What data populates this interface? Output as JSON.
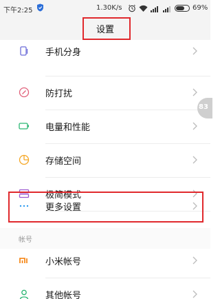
{
  "status_bar": {
    "time": "下午2:25",
    "network_speed": "1.30K/s",
    "battery_percent": "69%",
    "battery_level": 0.69,
    "icons": [
      "shield-icon",
      "alarm-icon",
      "wifi-icon",
      "signal-icon"
    ]
  },
  "header": {
    "title": "设置"
  },
  "settings": {
    "items": [
      {
        "label": "手机分身",
        "icon": "dual-app-icon",
        "color": "#6b6bd8"
      },
      {
        "label": "防打扰",
        "icon": "do-not-disturb-icon",
        "color": "#e0607a"
      },
      {
        "label": "电量和性能",
        "icon": "battery-icon",
        "color": "#2bb673"
      },
      {
        "label": "存储空间",
        "icon": "storage-pie-icon",
        "color": "#f5a623"
      },
      {
        "label": "极简模式",
        "icon": "simple-mode-icon",
        "color": "#9b59d0"
      },
      {
        "label": "更多设置",
        "icon": "more-dots-icon",
        "color": "#2d9bf0"
      }
    ],
    "section_header": "帐号",
    "account_items": [
      {
        "label": "小米帐号",
        "icon": "mi-logo-icon",
        "color": "#f57c00"
      },
      {
        "label": "其他帐号",
        "icon": "person-icon",
        "color": "#2bb673"
      }
    ]
  },
  "scroll_indicator": "83",
  "colors": {
    "highlight": "#e0282c",
    "background": "#ffffff",
    "bar": "#f4f4f4"
  }
}
